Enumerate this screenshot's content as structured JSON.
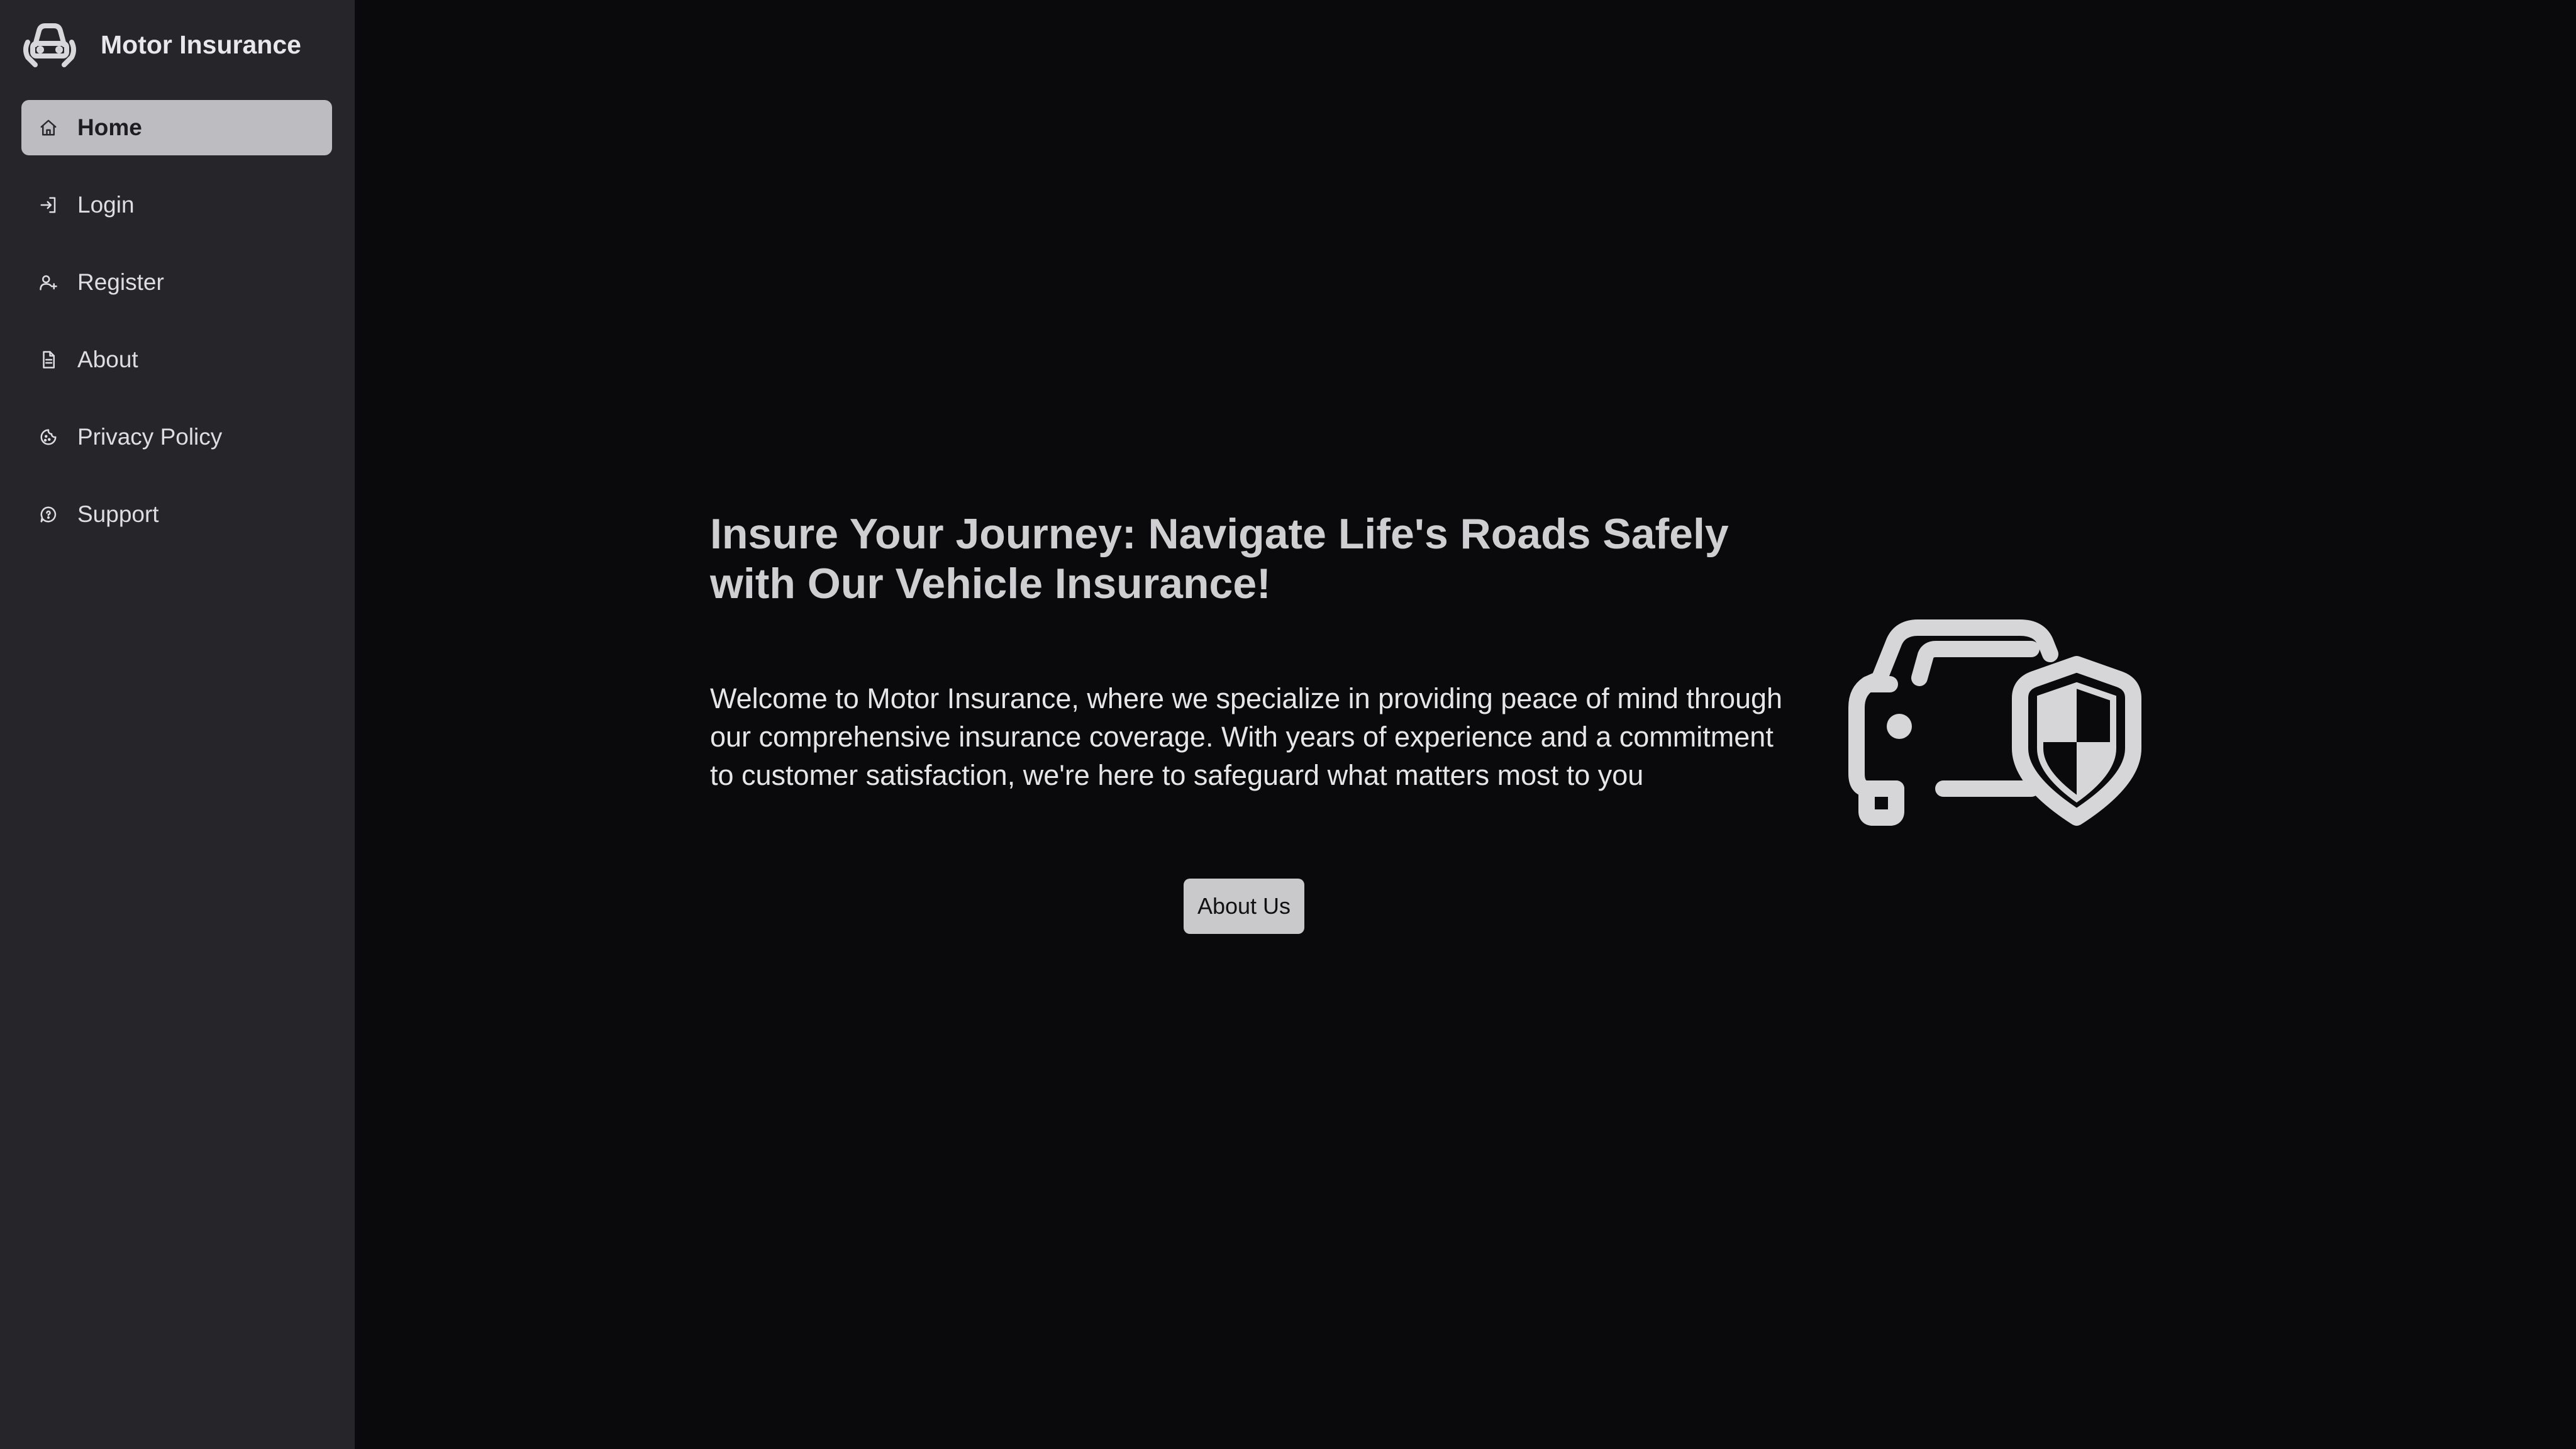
{
  "app": {
    "title": "Motor Insurance",
    "logo_icon": "car-shield-logo-icon"
  },
  "sidebar": {
    "items": [
      {
        "label": "Home",
        "icon": "home-icon",
        "active": true
      },
      {
        "label": "Login",
        "icon": "login-icon",
        "active": false
      },
      {
        "label": "Register",
        "icon": "user-plus-icon",
        "active": false
      },
      {
        "label": "About",
        "icon": "document-icon",
        "active": false
      },
      {
        "label": "Privacy Policy",
        "icon": "cookie-icon",
        "active": false
      },
      {
        "label": "Support",
        "icon": "help-chat-icon",
        "active": false
      }
    ]
  },
  "hero": {
    "title": "Insure Your Journey: Navigate Life's Roads Safely with Our Vehicle Insurance!",
    "text": "Welcome to Motor Insurance, where we specialize in providing peace of mind through our comprehensive insurance coverage. With years of experience and a commitment to customer satisfaction, we're here to safeguard what matters most to you",
    "button_label": "About Us",
    "illustration_icon": "car-shield-icon"
  },
  "colors": {
    "background": "#0a0a0c",
    "sidebar": "#26262a",
    "active_item": "#bdbdc1",
    "button": "#c9c9cc"
  }
}
